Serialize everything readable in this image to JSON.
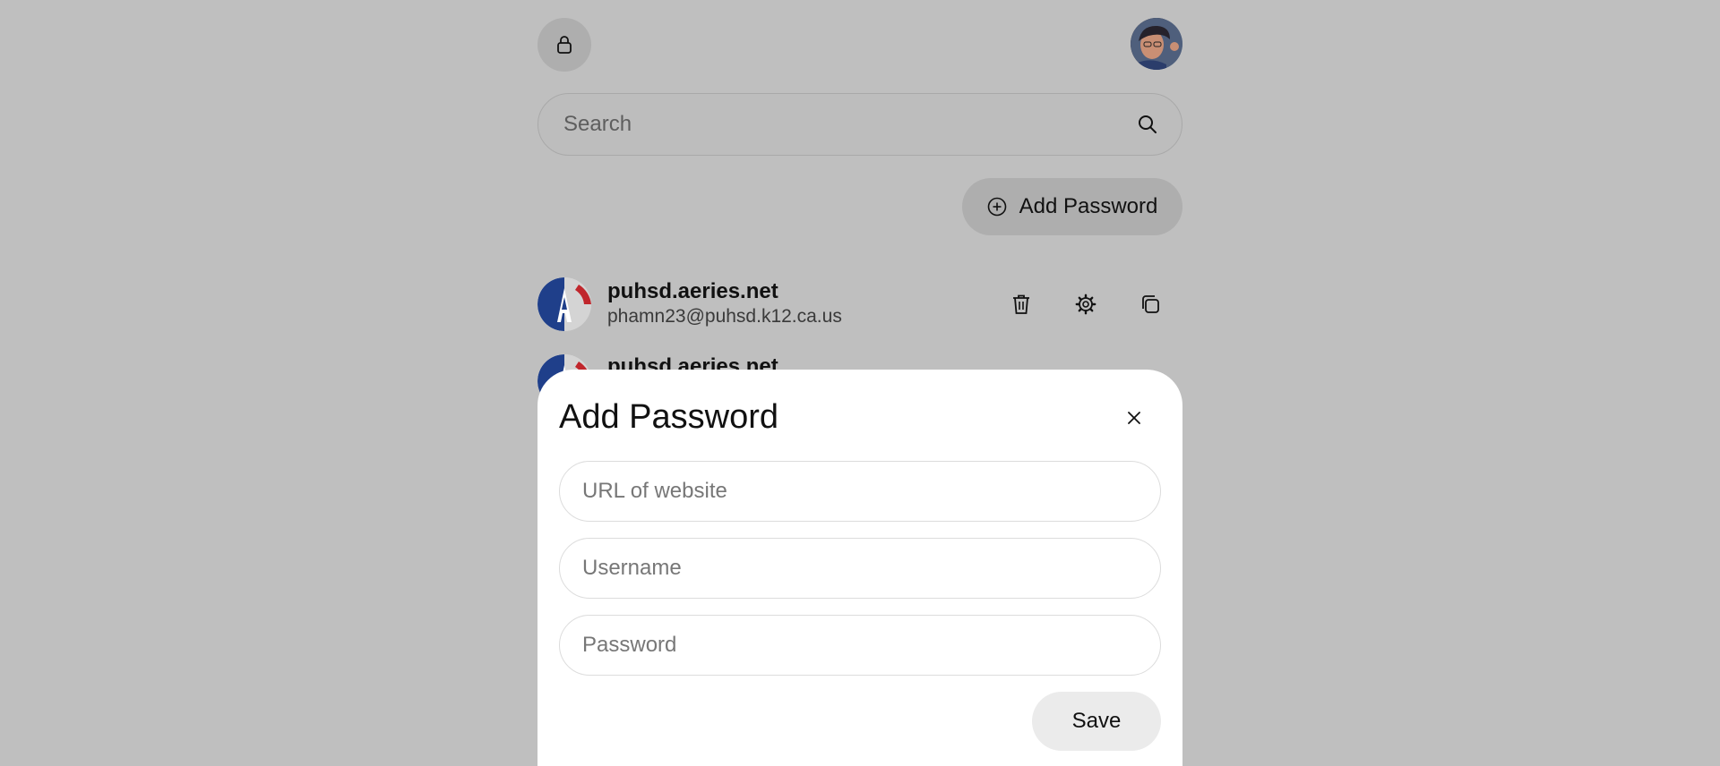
{
  "header": {
    "lock_icon": "lock-icon",
    "avatar_alt": "user-avatar"
  },
  "search": {
    "placeholder": "Search",
    "icon": "search-icon"
  },
  "toolbar": {
    "add_label": "Add Password",
    "add_icon": "plus-circle-icon"
  },
  "entries": [
    {
      "site": "puhsd.aeries.net",
      "username": "phamn23@puhsd.k12.ca.us"
    },
    {
      "site": "puhsd.aeries.net",
      "username": ""
    }
  ],
  "entry_actions": [
    "trash-icon",
    "gear-icon",
    "copy-icon"
  ],
  "modal": {
    "title": "Add Password",
    "close_icon": "close-icon",
    "fields": {
      "url_placeholder": "URL of website",
      "username_placeholder": "Username",
      "password_placeholder": "Password"
    },
    "save_label": "Save"
  },
  "colors": {
    "overlay_bg": "#bfbfbf",
    "button_bg": "#aeaeae",
    "modal_bg": "#ffffff",
    "save_bg": "#ebebeb",
    "logo_blue": "#1f3f8a",
    "logo_red": "#c0262c"
  }
}
